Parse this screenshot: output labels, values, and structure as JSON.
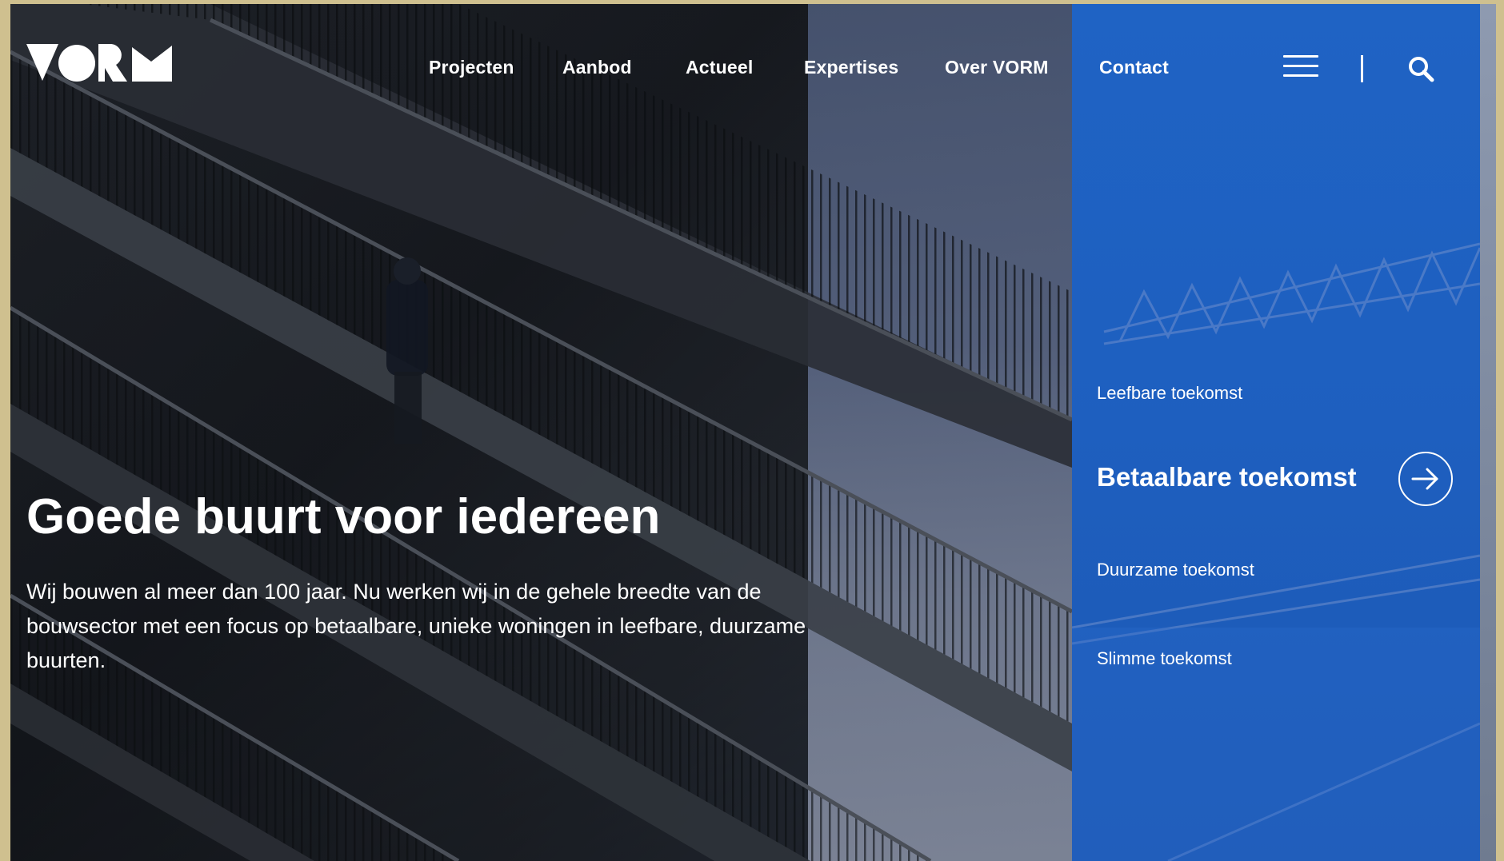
{
  "brand": {
    "logo_text": "VORM",
    "colors": {
      "panel_blue": "#1f63c4",
      "text": "#ffffff",
      "border": "#cfc08f"
    }
  },
  "nav": {
    "items": [
      {
        "label": "Projecten"
      },
      {
        "label": "Aanbod"
      },
      {
        "label": "Actueel"
      },
      {
        "label": "Expertises"
      },
      {
        "label": "Over VORM"
      },
      {
        "label": "Contact"
      }
    ],
    "icons": [
      "menu-icon",
      "search-icon"
    ]
  },
  "hero": {
    "title": "Goede buurt voor iedereen",
    "text": "Wij bouwen al meer dan 100 jaar. Nu werken wij in de gehele breedte van de bouwsector met een focus op betaalbare, unieke woningen in leefbare, duurzame buurten."
  },
  "panel": {
    "items": [
      {
        "label": "Leefbare toekomst"
      },
      {
        "label": "Betaalbare toekomst",
        "active": true
      },
      {
        "label": "Duurzame toekomst"
      },
      {
        "label": "Slimme toekomst"
      }
    ],
    "action_icon": "arrow-right-circle-icon"
  }
}
